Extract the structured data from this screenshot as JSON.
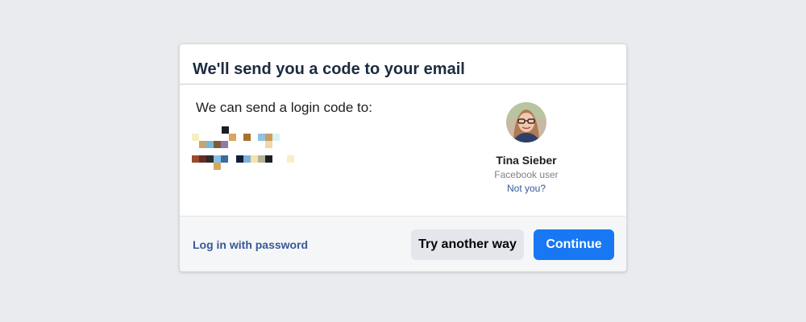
{
  "dialog": {
    "title": "We'll send you a code to your email",
    "body_text": "We can send a login code to:",
    "redacted_email_colors": [
      "#1c1e21",
      "#f7efc4",
      "#d8a65c",
      "#a9702f",
      "#8fc2e4",
      "#c99b5e",
      "#d7f3f3",
      "#c6a56b",
      "#79b5d9",
      "#7b5b3b",
      "#8e7da0",
      "#f3d8a6",
      "#9b4a2e",
      "#6a2a24",
      "#2b2b2b",
      "#8ac0e6",
      "#3e6b9a",
      "#0f1f3a",
      "#7fb0d9",
      "#f4e4a8",
      "#b4b39a"
    ]
  },
  "profile": {
    "avatar_icon": "user-avatar-photo",
    "name": "Tina Sieber",
    "subtitle": "Facebook user",
    "not_you": "Not you?"
  },
  "footer": {
    "password_link": "Log in with password",
    "try_another_label": "Try another way",
    "continue_label": "Continue"
  },
  "colors": {
    "primary": "#1877f2",
    "link": "#385898",
    "background": "#e9ebee"
  }
}
